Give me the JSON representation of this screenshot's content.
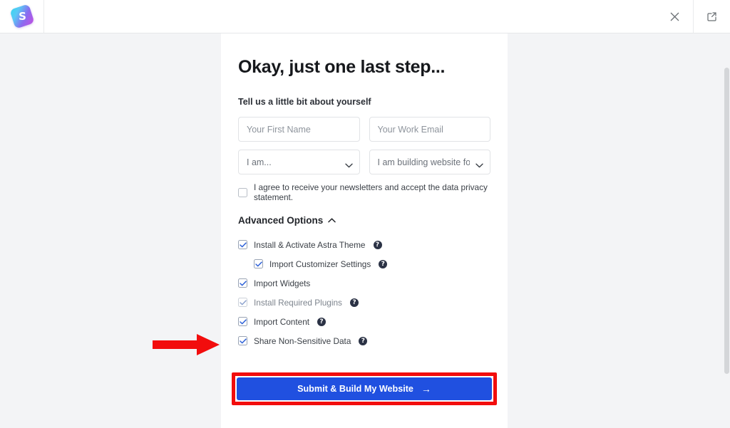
{
  "topbar": {
    "logo_glyph": "S",
    "logo_name": "starter-templates-logo",
    "close_label": "×",
    "open_new_label": "open-in-new"
  },
  "card": {
    "headline": "Okay, just one last step...",
    "subhead": "Tell us a little bit about yourself",
    "fields": {
      "first_name": {
        "placeholder": "Your First Name",
        "value": ""
      },
      "work_email": {
        "placeholder": "Your Work Email",
        "value": ""
      },
      "i_am": {
        "selected": "I am...",
        "options": [
          "I am..."
        ]
      },
      "building_for": {
        "selected": "I am building website for...",
        "options": [
          "I am building website for..."
        ]
      }
    },
    "consent": {
      "label": "I agree to receive your newsletters and accept the data privacy statement.",
      "checked": false
    },
    "advanced": {
      "toggle_label": "Advanced Options",
      "expanded": true,
      "options": [
        {
          "label": "Install & Activate Astra Theme",
          "checked": true,
          "help": "?",
          "indent": false,
          "dim": false
        },
        {
          "label": "Import Customizer Settings",
          "checked": true,
          "help": "?",
          "indent": true,
          "dim": false
        },
        {
          "label": "Import Widgets",
          "checked": true,
          "help": "",
          "indent": false,
          "dim": false
        },
        {
          "label": "Install Required Plugins",
          "checked": true,
          "help": "?",
          "indent": false,
          "dim": true
        },
        {
          "label": "Import Content",
          "checked": true,
          "help": "?",
          "indent": false,
          "dim": false
        },
        {
          "label": "Share Non-Sensitive Data",
          "checked": true,
          "help": "?",
          "indent": false,
          "dim": false
        }
      ]
    },
    "submit": {
      "label": "Submit & Build My Website",
      "arrow": "→"
    }
  },
  "annotations": {
    "highlight_color": "#f20d0d",
    "arrow_color": "#f20d0d",
    "button_color": "#2050e0"
  }
}
